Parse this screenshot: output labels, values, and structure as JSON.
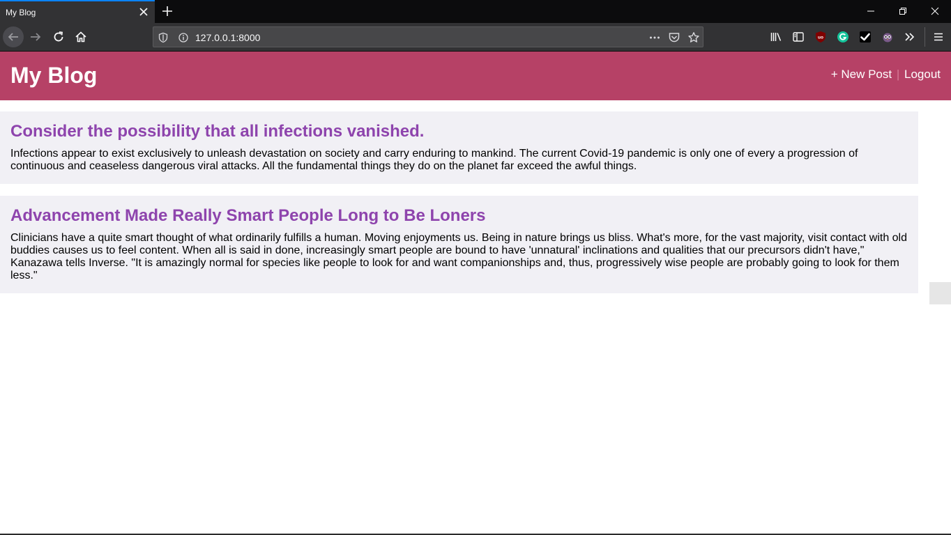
{
  "browser": {
    "tab_title": "My Blog",
    "url": "127.0.0.1:8000"
  },
  "blog": {
    "brand": "My Blog",
    "nav": {
      "new_post": "+ New Post",
      "divider": "|",
      "logout": "Logout"
    },
    "posts": [
      {
        "title": "Consider the possibility that all infections vanished.",
        "body": "Infections appear to exist exclusively to unleash devastation on society and carry enduring to mankind. The current Covid-19 pandemic is only one of every a progression of continuous and ceaseless dangerous viral attacks. All the fundamental things they do on the planet far exceed the awful things."
      },
      {
        "title": "Advancement Made Really Smart People Long to Be Loners",
        "body": "Clinicians have a quite smart thought of what ordinarily fulfills a human. Moving enjoyments us. Being in nature brings us bliss. What's more, for the vast majority, visit contact with old buddies causes us to feel content. When all is said in done, increasingly smart people are bound to have 'unnatural' inclinations and qualities that our precursors didn't have,\" Kanazawa tells Inverse. \"It is amazingly normal for species like people to look for and want companionships and, thus, progressively wise people are probably going to look for them less.\""
      }
    ]
  },
  "colors": {
    "header_bg": "#b64166",
    "post_title": "#8e44ad",
    "post_bg": "#f1f0f5"
  }
}
